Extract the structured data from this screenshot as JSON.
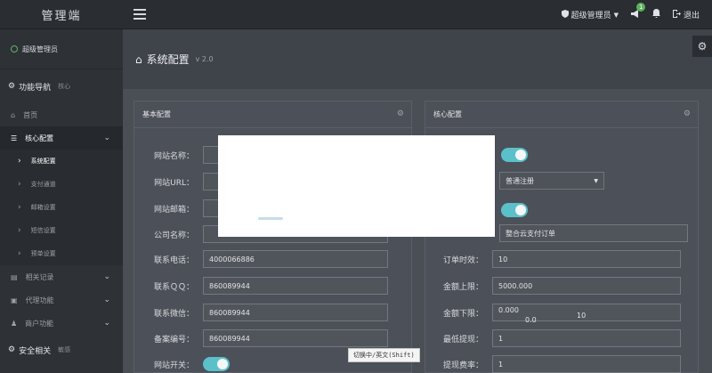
{
  "brand": "管理端",
  "topbar": {
    "notif_count": "1",
    "user_menu": "超级管理员",
    "logout": "退出"
  },
  "sidebar": {
    "user": "超级管理员",
    "section_nav": "功能导航",
    "section_nav_sub": "核心",
    "items": [
      {
        "label": "首页",
        "icon": "home-icon"
      },
      {
        "label": "核心配置",
        "icon": "sliders-icon"
      },
      {
        "label": "相关记录",
        "icon": "list-icon"
      },
      {
        "label": "代理功能",
        "icon": "lock-icon"
      },
      {
        "label": "商户功能",
        "icon": "users-icon"
      }
    ],
    "sub_items": [
      "系统配置",
      "支付通道",
      "邮箱设置",
      "短信设置",
      "预单设置"
    ],
    "section_security": "安全相关",
    "section_security_sub": "敏感"
  },
  "page": {
    "title": "系统配置",
    "version": "v 2.0"
  },
  "left_panel": {
    "title": "基本配置",
    "fields": [
      {
        "label": "网站名称：",
        "value": ""
      },
      {
        "label": "网站URL：",
        "value": ""
      },
      {
        "label": "网站邮箱：",
        "value": ""
      },
      {
        "label": "公司名称：",
        "value": ""
      },
      {
        "label": "联系电话：",
        "value": "4000066886"
      },
      {
        "label": "联系ＱＱ：",
        "value": "860089944"
      },
      {
        "label": "联系微信：",
        "value": "860089944"
      },
      {
        "label": "备案编号：",
        "value": "860089944"
      }
    ],
    "switch_label": "网站开关："
  },
  "right_panel": {
    "title": "核心配置",
    "select_value": "普通注册",
    "order_name_value": "整合云支付订单",
    "fields": [
      {
        "label": "订单时效：",
        "value": "10"
      },
      {
        "label": "金额上限：",
        "value": "5000.000"
      },
      {
        "label": "金额下限：",
        "value": "0.000"
      },
      {
        "label": "最低提现：",
        "value": "1"
      },
      {
        "label": "提现费率：",
        "value": "1"
      }
    ],
    "floating": [
      "0.0",
      "10"
    ]
  },
  "ime_tooltip": "切换中/英文(Shift)"
}
